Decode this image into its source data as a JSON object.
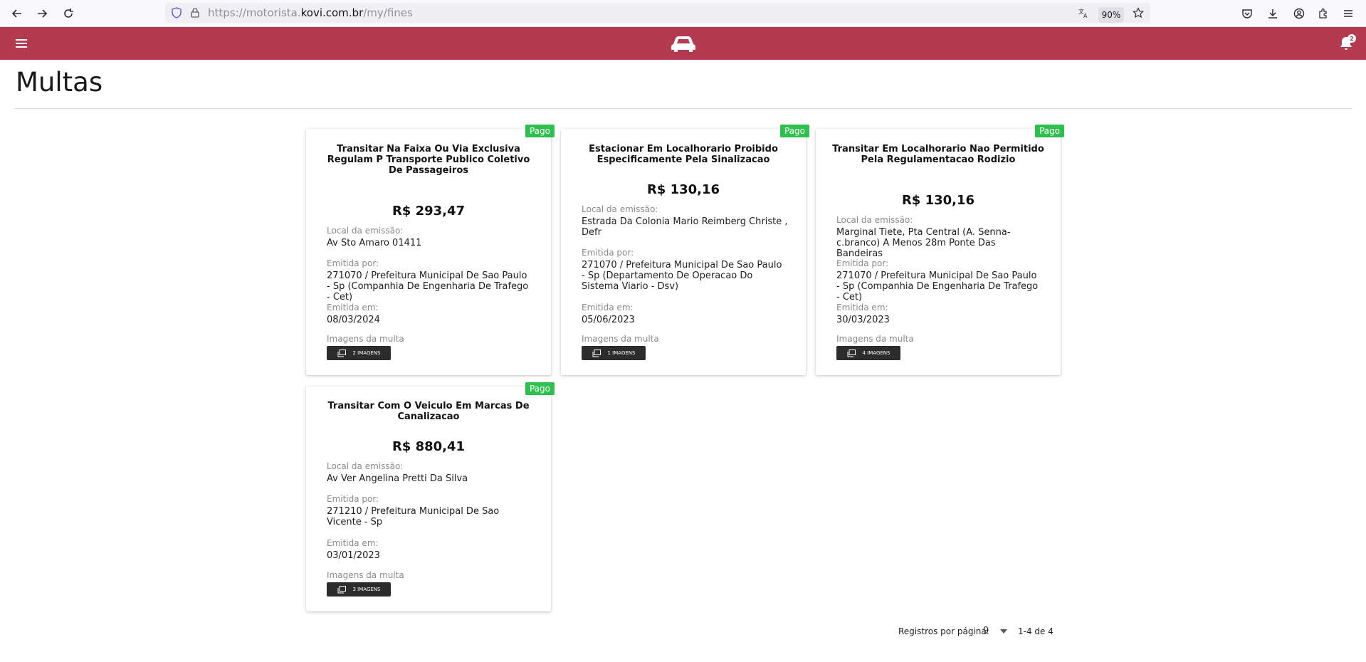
{
  "browser": {
    "url_prefix": "https://motorista.",
    "url_domain": "kovi.com.br",
    "url_path": "/my/fines",
    "zoom": "90%"
  },
  "header": {
    "notification_count": "2"
  },
  "page": {
    "title": "Multas"
  },
  "labels": {
    "local": "Local da emissão:",
    "emitida_por": "Emitida por:",
    "emitida_em": "Emitida em:",
    "imagens": "Imagens da multa"
  },
  "fines": [
    {
      "status": "Pago",
      "title": "Transitar Na Faixa Ou Via Exclusiva Regulam P Transporte Publico Coletivo De Passageiros",
      "amount": "R$ 293,47",
      "local": "Av Sto Amaro 01411",
      "emitida_por": "271070 / Prefeitura Municipal De Sao Paulo - Sp (Companhia De Engenharia De Trafego - Cet)",
      "emitida_em": "08/03/2024",
      "images_button": "2 IMAGENS"
    },
    {
      "status": "Pago",
      "title": "Estacionar Em Localhorario Proibido Especificamente Pela Sinalizacao",
      "amount": "R$ 130,16",
      "local": "Estrada Da Colonia Mario Reimberg Christe , Defr",
      "emitida_por": "271070 / Prefeitura Municipal De Sao Paulo - Sp (Departamento De Operacao Do Sistema Viario - Dsv)",
      "emitida_em": "05/06/2023",
      "images_button": "1 IMAGENS"
    },
    {
      "status": "Pago",
      "title": "Transitar Em Localhorario Nao Permitido Pela Regulamentacao Rodizio",
      "amount": "R$ 130,16",
      "local": "Marginal Tiete, Pta Central (A. Senna-c.branco) A Menos 28m Ponte Das Bandeiras",
      "emitida_por": "271070 / Prefeitura Municipal De Sao Paulo - Sp (Companhia De Engenharia De Trafego - Cet)",
      "emitida_em": "30/03/2023",
      "images_button": "4 IMAGENS"
    },
    {
      "status": "Pago",
      "title": "Transitar Com O Veiculo Em Marcas De Canalizacao",
      "amount": "R$ 880,41",
      "local": "Av Ver Angelina Pretti Da Silva",
      "emitida_por": "271210 / Prefeitura Municipal De Sao Vicente - Sp",
      "emitida_em": "03/01/2023",
      "images_button": "3 IMAGENS"
    }
  ],
  "pagination": {
    "rows_label": "Registros por página:",
    "rows_value": "9",
    "range": "1-4 de 4"
  }
}
